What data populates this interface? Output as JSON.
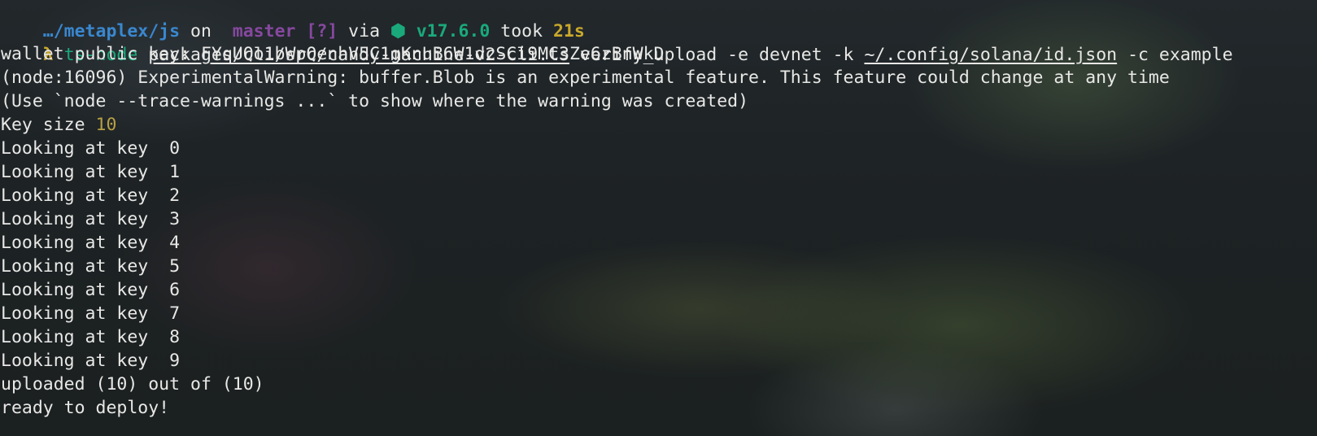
{
  "prompt": {
    "path": "…/metaplex/js",
    "on": " on ",
    "branch_icon": "",
    "branch_icon_name": "git-branch-icon",
    "branch": " master",
    "status": " [?]",
    "via": " via ",
    "node_icon": "⬢",
    "node_icon_name": "nodejs-icon",
    "node_version": " v17.6.0",
    "took": " took ",
    "duration": "21s"
  },
  "command": {
    "prompt_symbol": "λ",
    "program": "ts-node",
    "script_path": "packages/cli/src/candy-machine-v2-cli.ts",
    "args_part1": " verify_upload -e devnet -k ",
    "keypair_path": "~/.config/solana/id.json",
    "args_part2": " -c example"
  },
  "output": {
    "wallet_line": "wallet public key: FYqUQo1bWpQenhV5C1gKnuB6W1dcSCi9MC3Ze6zBnWkD",
    "warning_line": "(node:16096) ExperimentalWarning: buffer.Blob is an experimental feature. This feature could change at any time",
    "trace_line": "(Use `node --trace-warnings ...` to show where the warning was created)",
    "key_size_label": "Key size ",
    "key_size_value": "10",
    "looking_lines": [
      "Looking at key  0",
      "Looking at key  1",
      "Looking at key  2",
      "Looking at key  3",
      "Looking at key  4",
      "Looking at key  5",
      "Looking at key  6",
      "Looking at key  7",
      "Looking at key  8",
      "Looking at key  9"
    ],
    "uploaded_line": "uploaded (10) out of (10)",
    "ready_line": "ready to deploy!"
  },
  "colors": {
    "path": "#3a87cf",
    "git_branch": "#86489f",
    "node": "#1aa97b",
    "duration": "#c9a82c",
    "number": "#b7a043",
    "text": "#e8e8e6"
  }
}
